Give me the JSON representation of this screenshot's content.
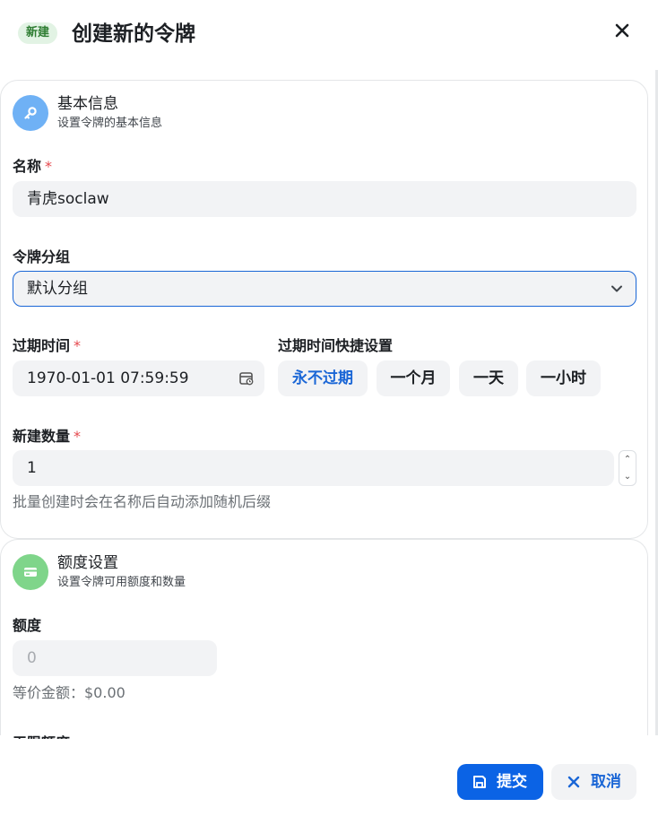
{
  "header": {
    "badge": "新建",
    "title": "创建新的令牌"
  },
  "basic_section": {
    "title": "基本信息",
    "subtitle": "设置令牌的基本信息",
    "name_label": "名称",
    "required_mark": "*",
    "name_value": "青虎soclaw",
    "group_label": "令牌分组",
    "group_value": "默认分组",
    "expire_label": "过期时间",
    "expire_value": "1970-01-01 07:59:59",
    "quick_label": "过期时间快捷设置",
    "quick_options": [
      "永不过期",
      "一个月",
      "一天",
      "一小时"
    ],
    "count_label": "新建数量",
    "count_value": "1",
    "count_help": "批量创建时会在名称后自动添加随机后缀"
  },
  "quota_section": {
    "title": "额度设置",
    "subtitle": "设置令牌可用额度和数量",
    "quota_label": "额度",
    "quota_placeholder": "0",
    "equivalent": "等价金额：$0.00",
    "next_label_partial": "无限额度"
  },
  "footer": {
    "submit": "提交",
    "cancel": "取消"
  },
  "colors": {
    "primary": "#0b63e5",
    "required": "#e5484d",
    "badge_bg": "#e2f3e4",
    "basic_icon": "#6fb1f5",
    "quota_icon": "#7fd58a"
  }
}
